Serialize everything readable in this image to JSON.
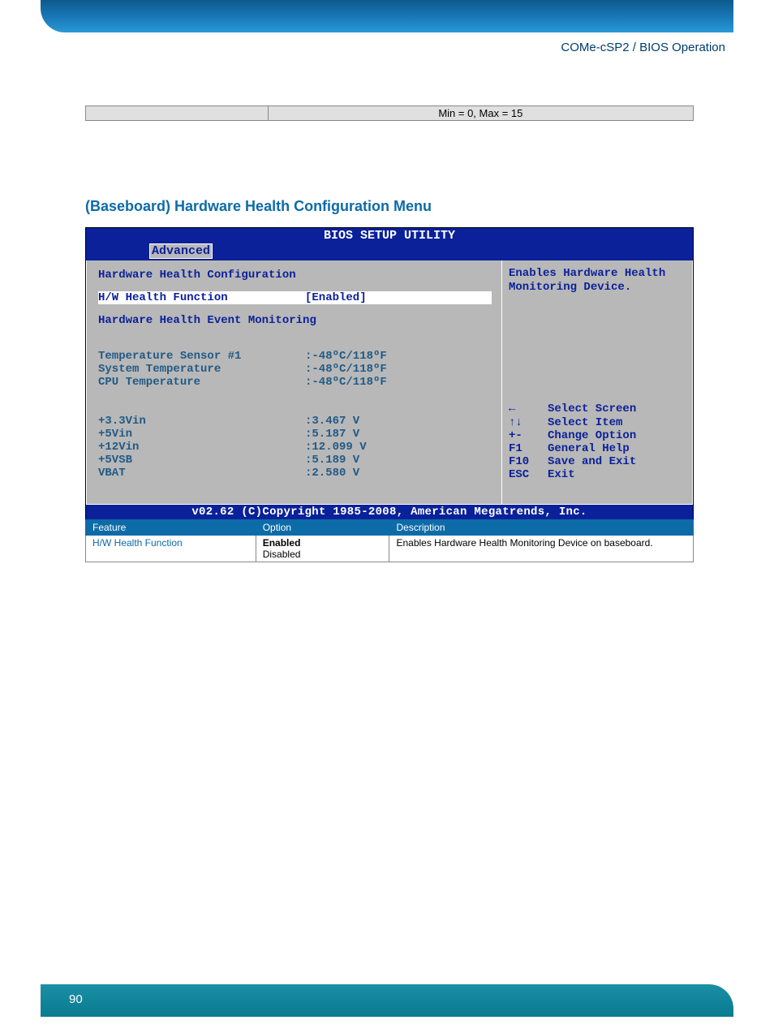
{
  "breadcrumb": "COMe-cSP2 / BIOS Operation",
  "top_table": {
    "col1": "",
    "col2": "Min = 0, Max = 15"
  },
  "section_title": "(Baseboard) Hardware Health Configuration Menu",
  "bios": {
    "title": "BIOS SETUP UTILITY",
    "tab": "Advanced",
    "heading1": "Hardware Health Configuration",
    "selected": {
      "label": "H/W Health Function",
      "value": "[Enabled]"
    },
    "heading2": "Hardware Health Event Monitoring",
    "sensors": [
      {
        "label": "Temperature Sensor #1",
        "value": ":-48ºC/118ºF"
      },
      {
        "label": "System Temperature",
        "value": ":-48ºC/118ºF"
      },
      {
        "label": "CPU Temperature",
        "value": ":-48ºC/118ºF"
      }
    ],
    "voltages": [
      {
        "label": "+3.3Vin",
        "value": ":3.467 V"
      },
      {
        "label": "+5Vin",
        "value": ":5.187 V"
      },
      {
        "label": "+12Vin",
        "value": ":12.099 V"
      },
      {
        "label": "+5VSB",
        "value": ":5.189 V"
      },
      {
        "label": "VBAT",
        "value": ":2.580 V"
      }
    ],
    "help": "Enables Hardware Health Monitoring Device.",
    "nav": [
      {
        "key": "←",
        "text": "Select Screen"
      },
      {
        "key": "↑↓",
        "text": "Select Item"
      },
      {
        "key": "+-",
        "text": "Change Option"
      },
      {
        "key": "F1",
        "text": "General Help"
      },
      {
        "key": "F10",
        "text": "Save and Exit"
      },
      {
        "key": "ESC",
        "text": "Exit"
      }
    ],
    "footer": "v02.62 (C)Copyright 1985-2008, American Megatrends, Inc."
  },
  "feature_table": {
    "headers": {
      "feature": "Feature",
      "option": "Option",
      "description": "Description"
    },
    "rows": [
      {
        "feature": "H/W Health Function",
        "options": [
          "Enabled",
          "Disabled"
        ],
        "description": "Enables Hardware Health Monitoring Device on baseboard."
      }
    ]
  },
  "page_number": "90"
}
